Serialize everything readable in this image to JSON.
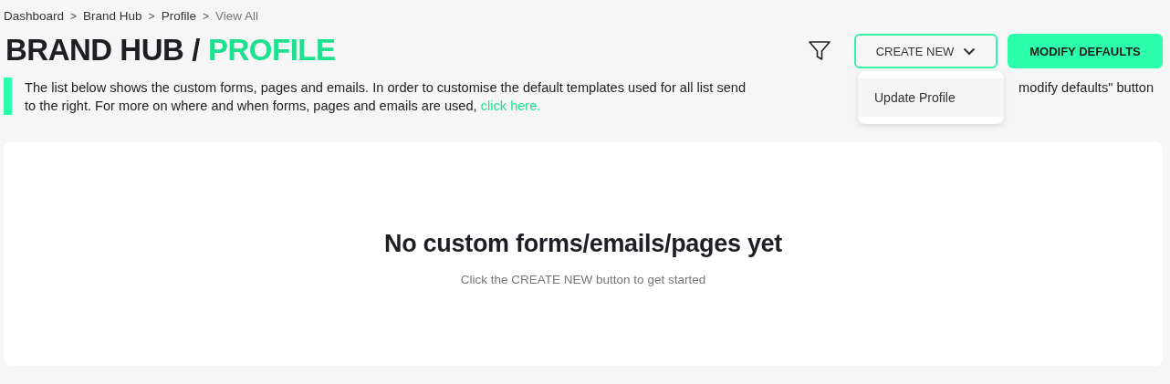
{
  "breadcrumb": [
    {
      "label": "Dashboard",
      "current": false
    },
    {
      "label": "Brand Hub",
      "current": false
    },
    {
      "label": "Profile",
      "current": false
    },
    {
      "label": "View All",
      "current": true
    }
  ],
  "breadcrumb_separator": ">",
  "title": {
    "section": "BRAND HUB",
    "separator": "/",
    "page": "PROFILE"
  },
  "toolbar": {
    "create_button": "CREATE NEW",
    "modify_button": "MODIFY DEFAULTS",
    "create_menu": {
      "expanded": true,
      "items": [
        {
          "label": "Update Profile",
          "selected": true
        }
      ]
    }
  },
  "info": {
    "line_1_start": "The list below shows the custom forms, pages and emails. In order to customise the default templates used for all list send",
    "line_1_end": "modify defaults\" button",
    "line_2": "to the right. For more on where and when forms, pages and emails are used,",
    "link": "click here."
  },
  "empty_state": {
    "heading": "No custom forms/emails/pages yet",
    "hint": "Click the CREATE NEW button to get started"
  }
}
